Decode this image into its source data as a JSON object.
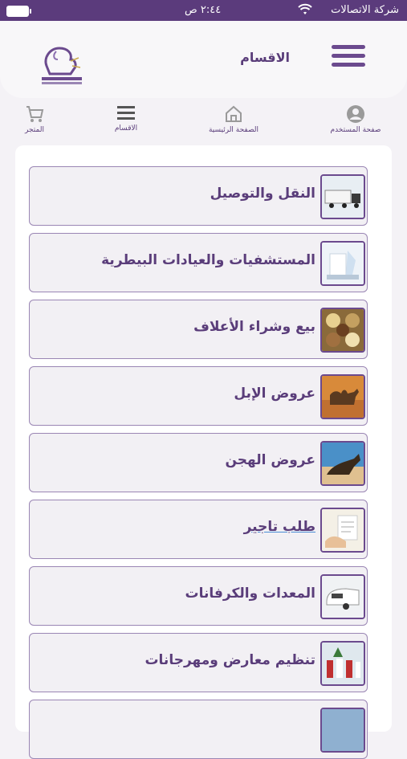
{
  "status_bar": {
    "carrier": "شركة الاتصالات",
    "time": "٢:٤٤ ص"
  },
  "header": {
    "title": "الاقسام",
    "logo_icon": "camel-logo"
  },
  "nav": {
    "items": [
      {
        "label": "صفحة المستخدم",
        "icon": "user-icon"
      },
      {
        "label": "الصفحة الرئيسية",
        "icon": "home-icon"
      },
      {
        "label": "الاقسام",
        "icon": "list-icon"
      },
      {
        "label": "المتجر",
        "icon": "cart-icon"
      }
    ]
  },
  "categories": [
    {
      "label": "النقل والتوصيل",
      "icon": "truck-icon"
    },
    {
      "label": "المستشفيات والعيادات البيطرية",
      "icon": "veterinary-icon"
    },
    {
      "label": "بيع وشراء الأعلاف",
      "icon": "feed-icon"
    },
    {
      "label": "عروض الإبل",
      "icon": "camel-icon"
    },
    {
      "label": "عروض الهجن",
      "icon": "racing-camel-icon"
    },
    {
      "label": "طلب تاجير",
      "icon": "rental-icon"
    },
    {
      "label": "المعدات والكرفانات",
      "icon": "caravan-icon"
    },
    {
      "label": "تنظيم معارض ومهرجانات",
      "icon": "festival-icon"
    }
  ],
  "colors": {
    "primary": "#5b3b7c",
    "accent": "#6b4a8e"
  }
}
